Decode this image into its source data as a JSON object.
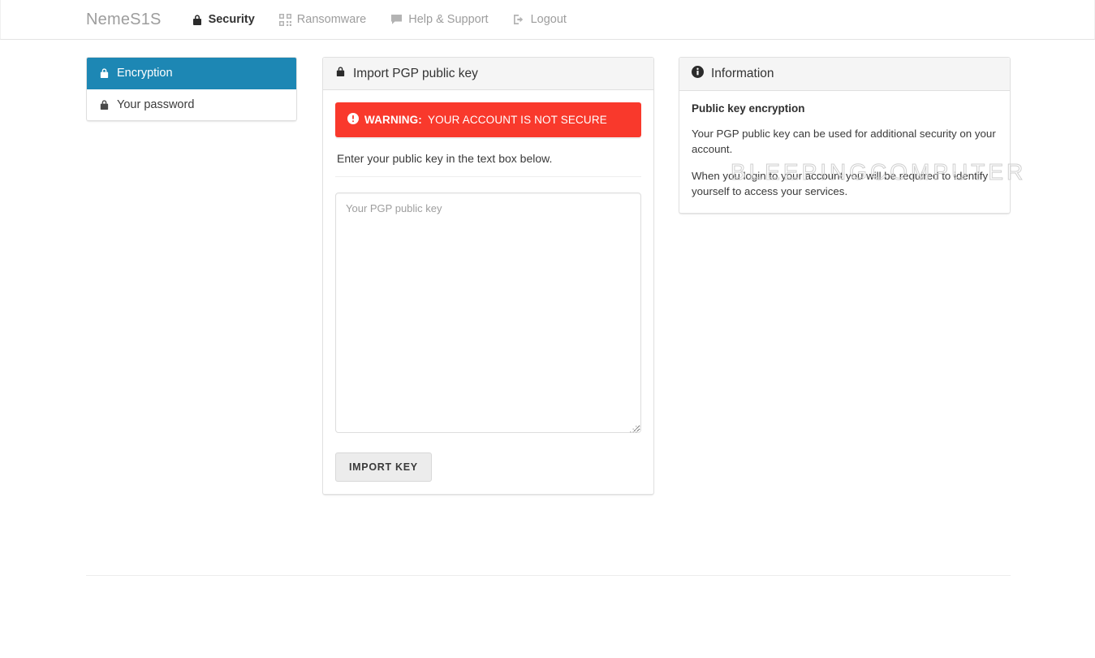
{
  "navbar": {
    "brand": "NemeS1S",
    "items": [
      {
        "label": "Security",
        "icon": "lock-icon",
        "active": true
      },
      {
        "label": "Ransomware",
        "icon": "qrcode-icon",
        "active": false
      },
      {
        "label": "Help & Support",
        "icon": "comment-icon",
        "active": false
      },
      {
        "label": "Logout",
        "icon": "sign-out-icon",
        "active": false
      }
    ]
  },
  "sidebar": {
    "items": [
      {
        "label": "Encryption",
        "icon": "lock-icon",
        "active": true
      },
      {
        "label": "Your password",
        "icon": "lock-icon",
        "active": false
      }
    ]
  },
  "main": {
    "panel_title": "Import PGP public key",
    "panel_icon": "lock-icon",
    "alert": {
      "icon": "exclamation-circle-icon",
      "label": "WARNING:",
      "text": "YOUR ACCOUNT IS NOT SECURE",
      "color": "#f9392c"
    },
    "helper_text": "Enter your public key in the text box below.",
    "textarea": {
      "placeholder": "Your PGP public key",
      "value": ""
    },
    "submit_label": "IMPORT KEY"
  },
  "info": {
    "panel_title": "Information",
    "panel_icon": "info-circle-icon",
    "heading": "Public key encryption",
    "paragraphs": [
      "Your PGP public key can be used for additional security on your account.",
      "When you login to your account you will be required to identify yourself to access your services."
    ]
  },
  "watermark": {
    "text": "BLEEPINGCOMPUTER"
  },
  "colors": {
    "accent": "#1d87b4",
    "danger": "#f9392c",
    "muted": "#9d9d9d"
  }
}
